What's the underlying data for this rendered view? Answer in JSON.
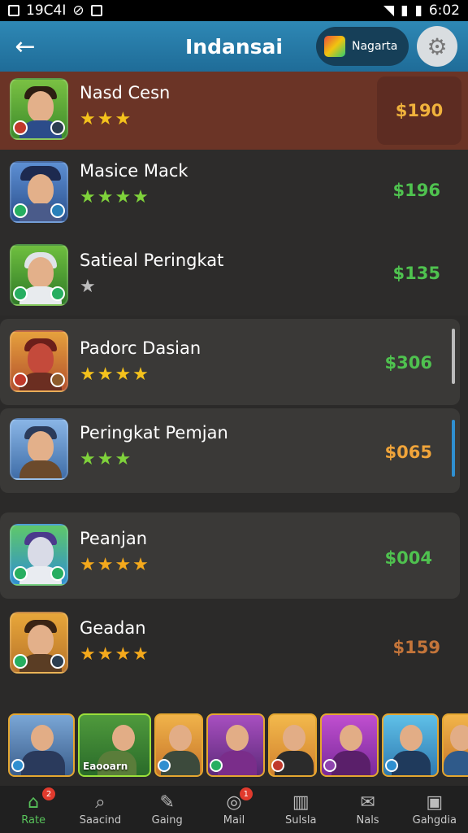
{
  "status_bar": {
    "carrier": "19C4I",
    "time": "6:02"
  },
  "app_bar": {
    "title": "Indansai",
    "region_label": "Nagarta"
  },
  "players": [
    {
      "name": "Nasd Cesn",
      "stars": "★★★",
      "price": "$190",
      "price_color": "#f0b23c",
      "star_color": "#f4c21c"
    },
    {
      "name": "Masice Mack",
      "stars": "★★★★",
      "price": "$196",
      "price_color": "#4fc24f",
      "star_color": "#7fd23b"
    },
    {
      "name": "Satieal Peringkat",
      "stars": "★",
      "price": "$135",
      "price_color": "#4fc24f",
      "star_color": "#bdbdbd"
    },
    {
      "name": "Padorc Dasian",
      "stars": "★★★★",
      "price": "$306",
      "price_color": "#4fc24f",
      "star_color": "#f4c21c"
    },
    {
      "name": "Peringkat Pemjan",
      "stars": "★★★",
      "price": "$065",
      "price_color": "#f0a43a",
      "star_color": "#7fd23b"
    },
    {
      "name": "Peanjan",
      "stars": "★★★★",
      "price": "$004",
      "price_color": "#4fc24f",
      "star_color": "#f4a91c"
    },
    {
      "name": "Geadan",
      "stars": "★★★★",
      "price": "$159",
      "price_color": "#c4753a",
      "star_color": "#f4a91c"
    }
  ],
  "carousel": {
    "featured_label": "Eaooarn"
  },
  "bottom_nav": [
    {
      "label": "Rate",
      "icon": "home-icon",
      "badge": "2"
    },
    {
      "label": "Saacind",
      "icon": "search-icon"
    },
    {
      "label": "Gaing",
      "icon": "pen-icon"
    },
    {
      "label": "Mail",
      "icon": "compass-icon",
      "badge": "1"
    },
    {
      "label": "Sulsla",
      "icon": "book-icon"
    },
    {
      "label": "Nals",
      "icon": "mail-icon"
    },
    {
      "label": "Gahgdia",
      "icon": "box-icon"
    }
  ]
}
